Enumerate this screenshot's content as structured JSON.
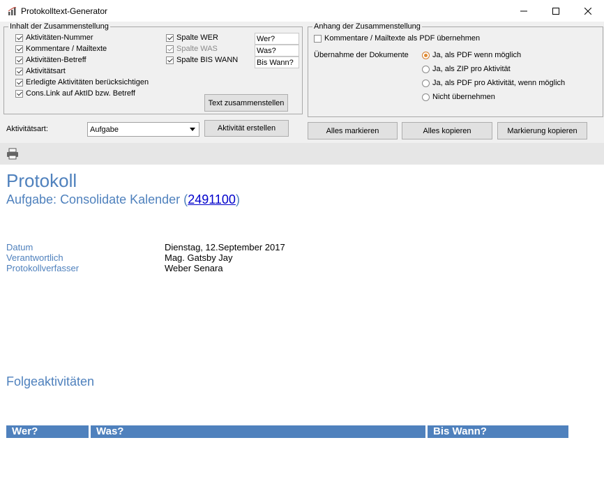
{
  "window": {
    "title": "Protokolltext-Generator"
  },
  "inhalt": {
    "legend": "Inhalt der Zusammenstellung",
    "checkboxes": [
      {
        "label": "Aktivitäten-Nummer",
        "checked": true
      },
      {
        "label": "Kommentare / Mailtexte",
        "checked": true
      },
      {
        "label": "Aktivitäten-Betreff",
        "checked": true
      },
      {
        "label": "Aktivitätsart",
        "checked": true
      },
      {
        "label": "Erledigte Aktivitäten berücksichtigen",
        "checked": true
      },
      {
        "label": "Cons.Link auf AktID bzw. Betreff",
        "checked": true
      }
    ],
    "spalten": [
      {
        "label": "Spalte WER",
        "checked": true,
        "disabled": false,
        "header": "Wer?"
      },
      {
        "label": "Spalte WAS",
        "checked": true,
        "disabled": true,
        "header": "Was?"
      },
      {
        "label": "Spalte BIS WANN",
        "checked": true,
        "disabled": false,
        "header": "Bis Wann?"
      }
    ],
    "compose_button": "Text zusammenstellen"
  },
  "anhang": {
    "legend": "Anhang der Zusammenstellung",
    "comments_pdf_label": "Kommentare / Mailtexte als PDF übernehmen",
    "docs_label": "Übernahme der Dokumente",
    "options": [
      {
        "label": "Ja, als PDF wenn möglich",
        "selected": true
      },
      {
        "label": "Ja, als ZIP pro Aktivität",
        "selected": false
      },
      {
        "label": "Ja, als PDF pro Aktivität, wenn möglich",
        "selected": false
      },
      {
        "label": "Nicht übernehmen",
        "selected": false
      }
    ]
  },
  "aktivitaet": {
    "label": "Aktivitätsart:",
    "value": "Aufgabe",
    "create_button": "Aktivität erstellen"
  },
  "actions": {
    "select_all": "Alles markieren",
    "copy_all": "Alles kopieren",
    "copy_selection": "Markierung kopieren"
  },
  "document": {
    "title": "Protokoll",
    "subtitle_prefix": "Aufgabe: Consolidate Kalender (",
    "subtitle_link": "2491100",
    "subtitle_suffix": ")",
    "fields": [
      {
        "label": "Datum",
        "value": "Dienstag, 12.September 2017"
      },
      {
        "label": "Verantwortlich",
        "value": "Mag. Gatsby Jay"
      },
      {
        "label": "Protokollverfasser",
        "value": "Weber Senara"
      }
    ],
    "followups_heading": "Folgeaktivitäten",
    "table_headers": [
      "Wer?",
      "Was?",
      "Bis Wann?"
    ]
  },
  "colors": {
    "accent": "#4f81bd",
    "radio_selected": "#e08a30"
  },
  "icons": {
    "app": "chart-icon",
    "print": "printer-icon"
  }
}
